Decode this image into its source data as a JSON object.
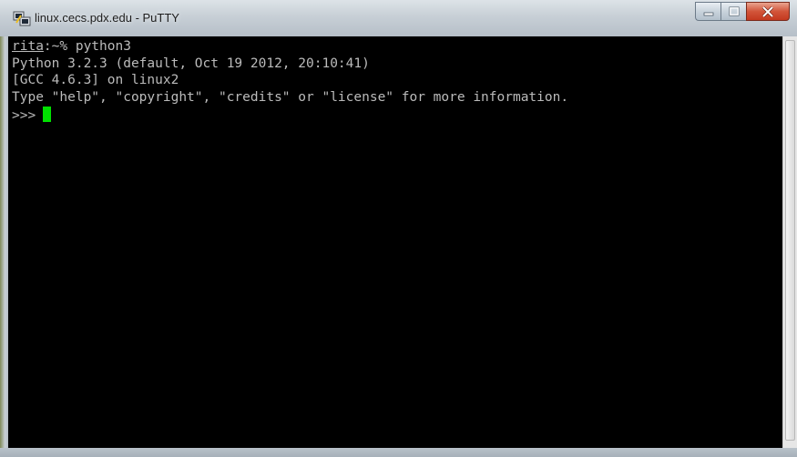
{
  "window": {
    "title": "linux.cecs.pdx.edu - PuTTY"
  },
  "caption_buttons": {
    "minimize_icon": "minimize-icon",
    "maximize_icon": "maximize-icon",
    "close_icon": "close-icon"
  },
  "terminal": {
    "user": "rita",
    "prompt_rest": ":~% python3",
    "lines": [
      "Python 3.2.3 (default, Oct 19 2012, 20:10:41)",
      "[GCC 4.6.3] on linux2",
      "Type \"help\", \"copyright\", \"credits\" or \"license\" for more information."
    ],
    "repl_prompt": ">>>",
    "cursor_color": "#00e000",
    "background_color": "#000000",
    "text_color": "#bbbbbb"
  }
}
